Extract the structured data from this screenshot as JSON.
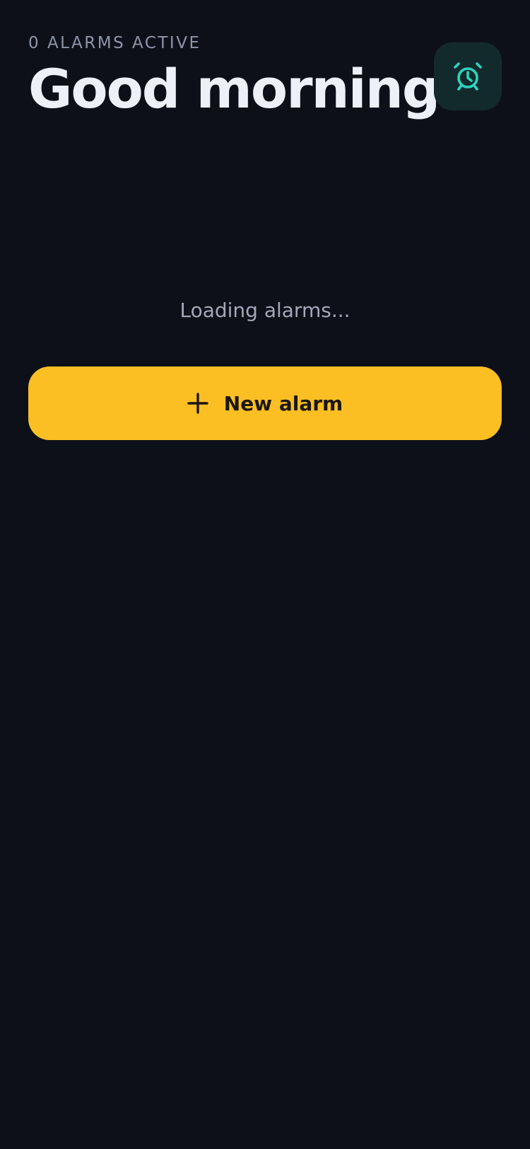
{
  "header": {
    "subtitle": "0 ALARMS ACTIVE",
    "title": "Good morning",
    "icon": "alarm-clock-icon"
  },
  "status": {
    "loading_text": "Loading alarms..."
  },
  "actions": {
    "new_alarm_label": "New alarm",
    "new_alarm_icon": "plus-icon"
  },
  "colors": {
    "background": "#0d1019",
    "accent_button": "#fbbf24",
    "icon_teal": "#2dd4bf",
    "icon_button_bg": "#132a2c"
  }
}
